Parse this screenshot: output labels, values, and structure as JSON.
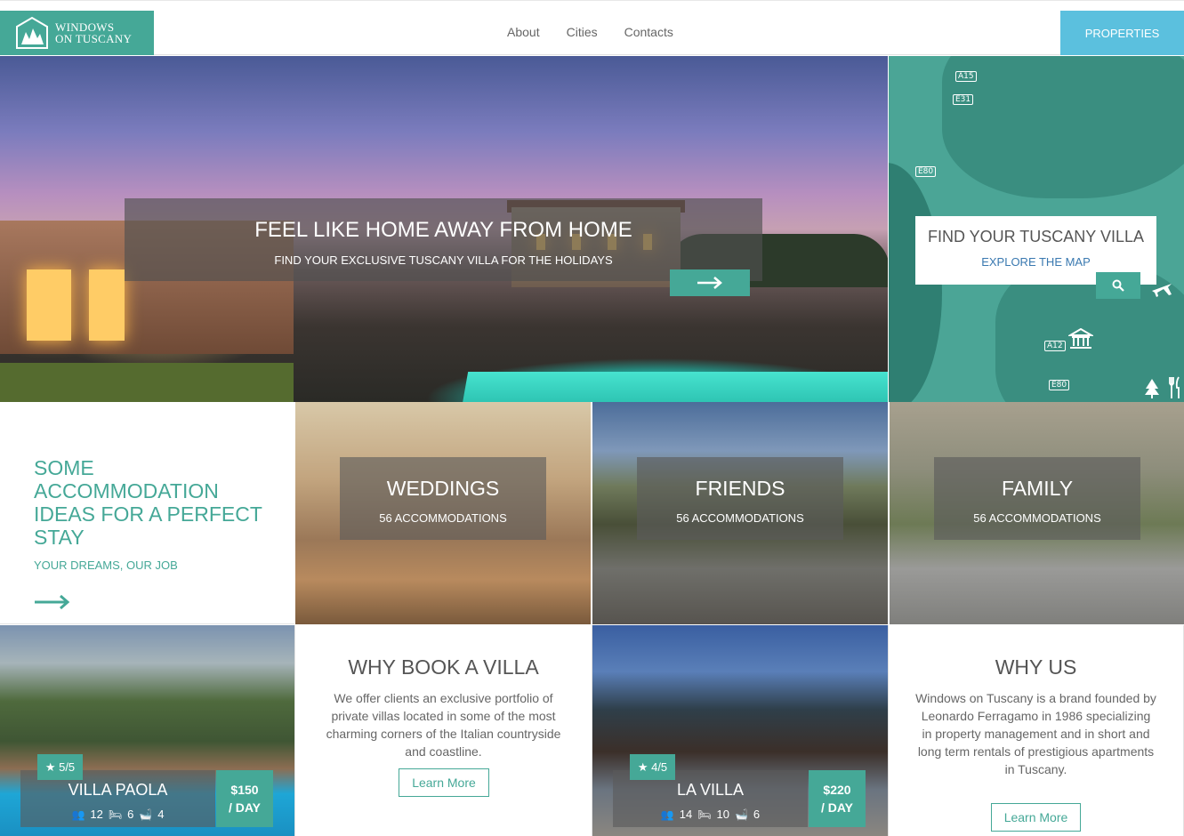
{
  "header": {
    "logo_line1": "WINDOWS",
    "logo_line2": "ON TUSCANY",
    "nav": [
      "About",
      "Cities",
      "Contacts"
    ],
    "properties_label": "PROPERTIES"
  },
  "hero": {
    "title": "FEEL LIKE HOME AWAY FROM HOME",
    "subtitle": "FIND YOUR EXCLUSIVE TUSCANY VILLA FOR THE HOLIDAYS",
    "arrow_icon": "arrow-right-icon"
  },
  "map": {
    "title": "FIND YOUR TUSCANY VILLA",
    "link": "EXPLORE THE MAP",
    "road_labels": [
      "A15",
      "E31",
      "E80",
      "A12",
      "E80"
    ],
    "search_icon": "search-icon"
  },
  "ideas": {
    "title": "SOME ACCOMMODATION IDEAS FOR A PERFECT STAY",
    "subtitle": "YOUR DREAMS, OUR JOB"
  },
  "categories": [
    {
      "title": "WEDDINGS",
      "count": "56 ACCOMMODATIONS"
    },
    {
      "title": "FRIENDS",
      "count": "56 ACCOMMODATIONS"
    },
    {
      "title": "FAMILY",
      "count": "56 ACCOMMODATIONS"
    }
  ],
  "villas": [
    {
      "name": "VILLA PAOLA",
      "rating": "5/5",
      "guests": "12",
      "beds": "6",
      "baths": "4",
      "price": "$150",
      "per": "/ DAY"
    },
    {
      "name": "LA VILLA",
      "rating": "4/5",
      "guests": "14",
      "beds": "10",
      "baths": "6",
      "price": "$220",
      "per": "/ DAY"
    }
  ],
  "why_book": {
    "title": "WHY BOOK A VILLA",
    "text": "We offer clients an exclusive portfolio of private villas located in some of the most charming corners of the Italian countryside and coastline.",
    "button": "Learn More"
  },
  "why_us": {
    "title": "WHY US",
    "text": "Windows on Tuscany is a brand founded by Leonardo Ferragamo in 1986 specializing in property management and in short and long term rentals of prestigious apartments in Tuscany.",
    "button": "Learn More"
  },
  "colors": {
    "accent": "#45a897",
    "properties": "#5bc0de"
  }
}
